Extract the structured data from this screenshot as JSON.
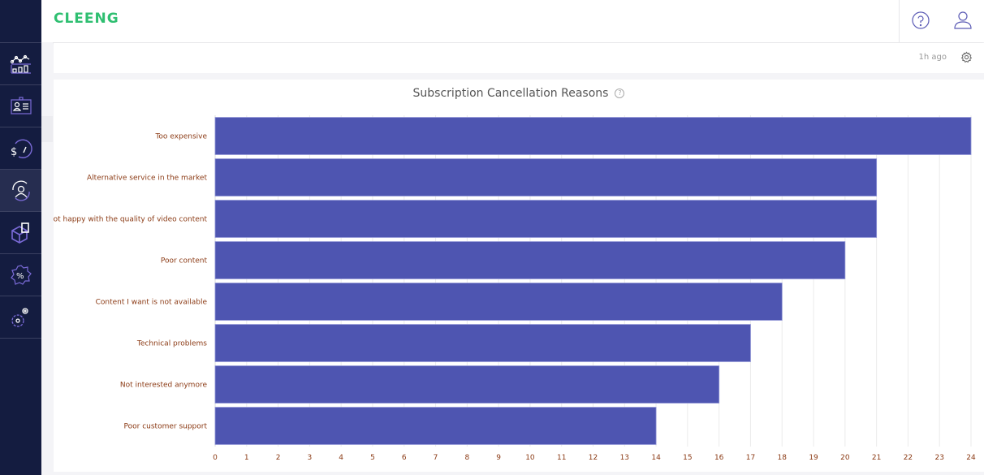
{
  "app": {
    "logo": "CLEENG"
  },
  "sidebar": {
    "items": [
      {
        "icon": "analytics-icon",
        "active": false
      },
      {
        "icon": "customer-card-icon",
        "active": false
      },
      {
        "icon": "revenue-gauge-icon",
        "active": false
      },
      {
        "icon": "retention-icon",
        "active": true
      },
      {
        "icon": "offers-icon",
        "active": false
      },
      {
        "icon": "discount-icon",
        "active": false
      },
      {
        "icon": "settings-icon",
        "active": false
      }
    ]
  },
  "header": {
    "help_icon": "help-icon",
    "user_icon": "user-icon"
  },
  "widget": {
    "updated": "1h ago",
    "settings_icon": "gear-icon"
  },
  "colors": {
    "bar": "#4e55b1",
    "label": "#8b3a14",
    "brand": "#2fbf71",
    "sidebar": "#141c40"
  },
  "chart_data": {
    "type": "bar",
    "orientation": "horizontal",
    "title": "Subscription Cancellation Reasons",
    "categories": [
      "Too expensive",
      "Alternative service in the market",
      "Not happy with the quality of video content",
      "Poor content",
      "Content I want is not available",
      "Technical problems",
      "Not interested anymore",
      "Poor customer support"
    ],
    "values": [
      24,
      21,
      21,
      20,
      18,
      17,
      16,
      14
    ],
    "xlim": [
      0,
      24
    ],
    "xticks": [
      "0",
      "1",
      "2",
      "3",
      "4",
      "5",
      "6",
      "7",
      "8",
      "9",
      "10",
      "11",
      "12",
      "13",
      "14",
      "15",
      "16",
      "17",
      "18",
      "19",
      "20",
      "21",
      "22",
      "23",
      "24"
    ],
    "grid": true,
    "xlabel": "",
    "ylabel": "",
    "legend": "none"
  }
}
